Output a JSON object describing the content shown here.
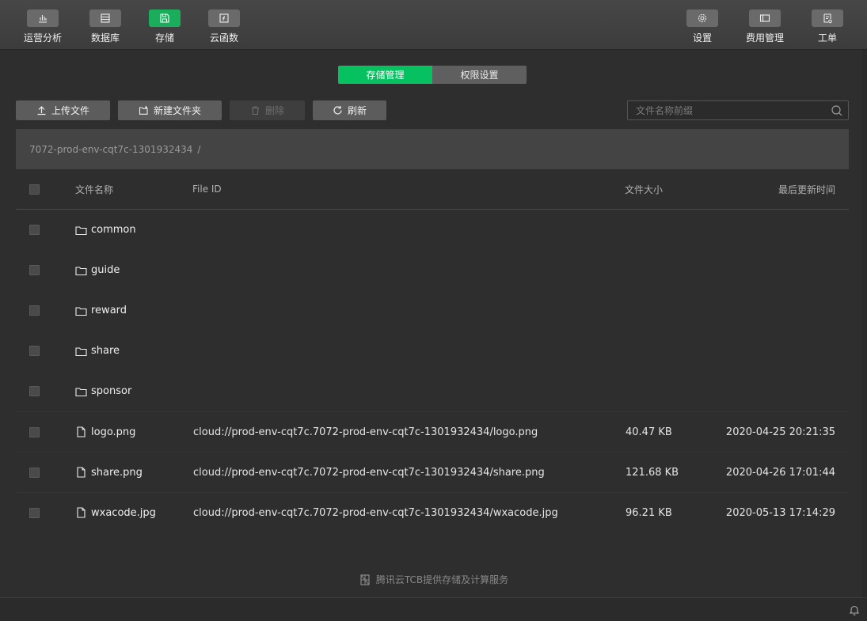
{
  "toolbar": {
    "left": [
      {
        "label": "运营分析",
        "icon": "bar-chart-icon"
      },
      {
        "label": "数据库",
        "icon": "database-icon"
      },
      {
        "label": "存储",
        "icon": "storage-icon"
      },
      {
        "label": "云函数",
        "icon": "cloud-function-icon"
      }
    ],
    "right": [
      {
        "label": "设置",
        "icon": "gear-icon"
      },
      {
        "label": "费用管理",
        "icon": "billing-icon"
      },
      {
        "label": "工单",
        "icon": "ticket-icon"
      }
    ],
    "active": "存储",
    "active_color": "#1aad5b"
  },
  "tabs": [
    {
      "label": "存储管理",
      "active": true
    },
    {
      "label": "权限设置",
      "active": false
    }
  ],
  "actions": {
    "upload": "上传文件",
    "new_folder": "新建文件夹",
    "delete": "删除",
    "refresh": "刷新"
  },
  "search": {
    "placeholder": "文件名称前缀",
    "value": ""
  },
  "breadcrumb": {
    "path": "7072-prod-env-cqt7c-1301932434",
    "separator": "/"
  },
  "table": {
    "columns": [
      "文件名称",
      "File ID",
      "文件大小",
      "最后更新时间"
    ],
    "rows": [
      {
        "type": "folder",
        "name": "common",
        "file_id": "",
        "size": "",
        "updated": ""
      },
      {
        "type": "folder",
        "name": "guide",
        "file_id": "",
        "size": "",
        "updated": ""
      },
      {
        "type": "folder",
        "name": "reward",
        "file_id": "",
        "size": "",
        "updated": ""
      },
      {
        "type": "folder",
        "name": "share",
        "file_id": "",
        "size": "",
        "updated": ""
      },
      {
        "type": "folder",
        "name": "sponsor",
        "file_id": "",
        "size": "",
        "updated": ""
      },
      {
        "type": "file",
        "name": "logo.png",
        "file_id": "cloud://prod-env-cqt7c.7072-prod-env-cqt7c-1301932434/logo.png",
        "size": "40.47 KB",
        "updated": "2020-04-25 20:21:35"
      },
      {
        "type": "file",
        "name": "share.png",
        "file_id": "cloud://prod-env-cqt7c.7072-prod-env-cqt7c-1301932434/share.png",
        "size": "121.68 KB",
        "updated": "2020-04-26 17:01:44"
      },
      {
        "type": "file",
        "name": "wxacode.jpg",
        "file_id": "cloud://prod-env-cqt7c.7072-prod-env-cqt7c-1301932434/wxacode.jpg",
        "size": "96.21 KB",
        "updated": "2020-05-13 17:14:29"
      }
    ]
  },
  "footer": {
    "powered_by": "腾讯云TCB提供存储及计算服务"
  }
}
